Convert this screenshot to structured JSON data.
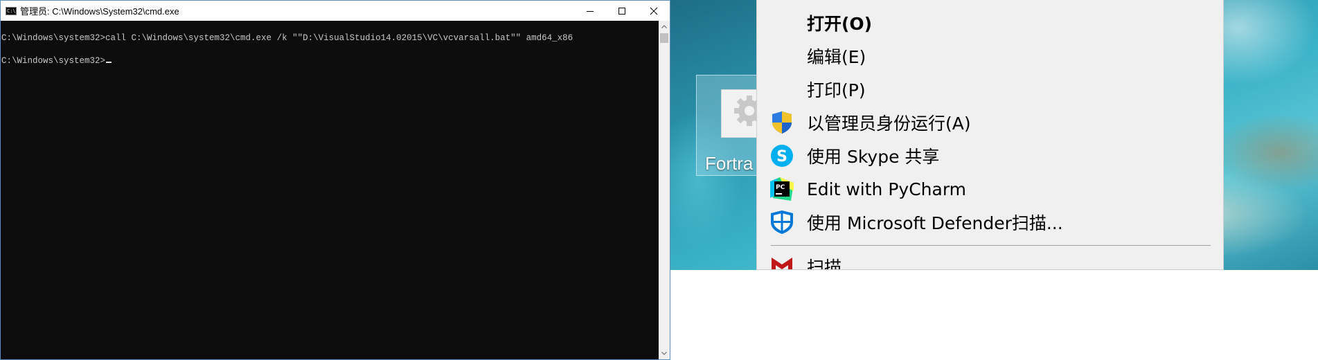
{
  "cmd": {
    "title": "管理员: C:\\Windows\\System32\\cmd.exe",
    "lines": [
      "C:\\Windows\\system32>call C:\\Windows\\system32\\cmd.exe /k \"\"D:\\VisualStudio14.02015\\VC\\vcvarsall.bat\"\" amd64_x86",
      "C:\\Windows\\system32>"
    ],
    "background_color": "#0c0c0c",
    "text_color": "#c8c8c8"
  },
  "desktop": {
    "icon_label": "Fortra"
  },
  "context_menu": {
    "items": [
      {
        "label": "打开(O)",
        "icon": "none"
      },
      {
        "label": "编辑(E)",
        "icon": "none"
      },
      {
        "label": "打印(P)",
        "icon": "none"
      },
      {
        "label": "以管理员身份运行(A)",
        "icon": "uac-shield-icon"
      },
      {
        "label": "使用 Skype 共享",
        "icon": "skype-icon"
      },
      {
        "label": "Edit with PyCharm",
        "icon": "pycharm-icon"
      },
      {
        "label": "使用 Microsoft Defender扫描...",
        "icon": "defender-shield-icon"
      },
      {
        "label": "扫描",
        "icon": "mcafee-icon"
      }
    ],
    "colors": {
      "skype": "#00aff0",
      "defender": "#0078d7",
      "mcafee": "#c01818"
    }
  }
}
